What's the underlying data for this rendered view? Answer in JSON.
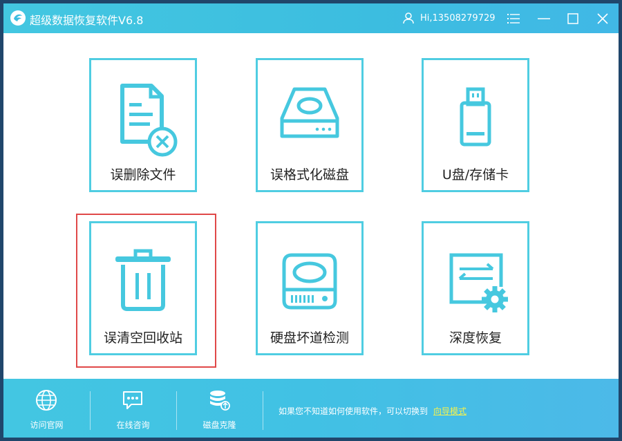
{
  "app": {
    "title": "超级数据恢复软件V6.8",
    "user": "Hi,13508279729"
  },
  "cards": [
    {
      "label": "误删除文件",
      "icon": "deleted-file-icon"
    },
    {
      "label": "误格式化磁盘",
      "icon": "hard-disk-icon"
    },
    {
      "label": "U盘/存储卡",
      "icon": "usb-drive-icon"
    },
    {
      "label": "误清空回收站",
      "icon": "trash-bin-icon",
      "selected": true
    },
    {
      "label": "硬盘坏道检测",
      "icon": "disk-scan-icon"
    },
    {
      "label": "深度恢复",
      "icon": "deep-recovery-icon"
    }
  ],
  "footer": {
    "tools": [
      {
        "label": "访问官网",
        "icon": "globe-icon"
      },
      {
        "label": "在线咨询",
        "icon": "chat-icon"
      },
      {
        "label": "磁盘克隆",
        "icon": "disk-clone-icon"
      }
    ],
    "hint": "如果您不知道如何使用软件，可以切换到",
    "guide_link": "向导模式"
  },
  "colors": {
    "accent": "#43c7e1",
    "card_border": "#4fcde2",
    "selected_outline": "#e04848",
    "link": "#f6f24d"
  }
}
